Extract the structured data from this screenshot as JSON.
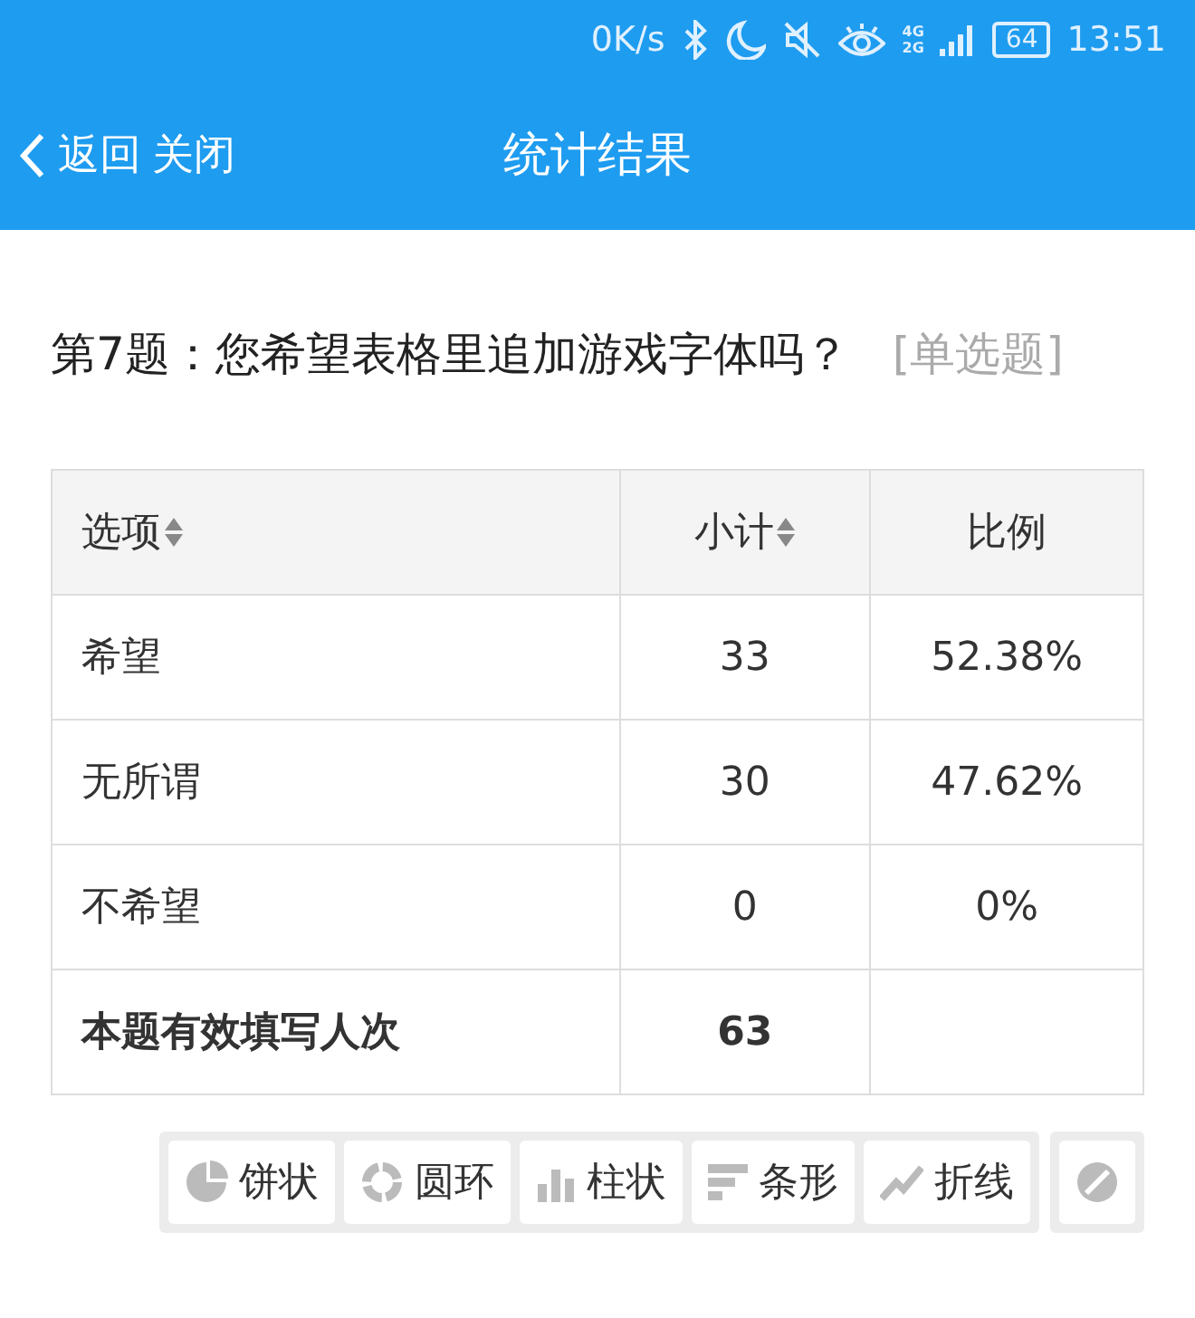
{
  "status_bar": {
    "speed": "0K/s",
    "network_top": "4G",
    "network_bottom": "2G",
    "battery": "64",
    "time": "13:51"
  },
  "nav": {
    "back": "返回",
    "close": "关闭",
    "title": "统计结果"
  },
  "question": {
    "text": "第7题：您希望表格里追加游戏字体吗？",
    "type": "[单选题]"
  },
  "table": {
    "columns": [
      {
        "label": "选项",
        "sortable": true
      },
      {
        "label": "小计",
        "sortable": true
      },
      {
        "label": "比例",
        "sortable": false
      }
    ],
    "rows": [
      {
        "option": "希望",
        "count": "33",
        "percent": "52.38%"
      },
      {
        "option": "无所谓",
        "count": "30",
        "percent": "47.62%"
      },
      {
        "option": "不希望",
        "count": "0",
        "percent": "0%"
      }
    ],
    "total": {
      "label": "本题有效填写人次",
      "count": "63"
    }
  },
  "chart_buttons": [
    {
      "kind": "pie",
      "label": "饼状"
    },
    {
      "kind": "ring",
      "label": "圆环"
    },
    {
      "kind": "column",
      "label": "柱状"
    },
    {
      "kind": "bar",
      "label": "条形"
    },
    {
      "kind": "line",
      "label": "折线"
    }
  ]
}
